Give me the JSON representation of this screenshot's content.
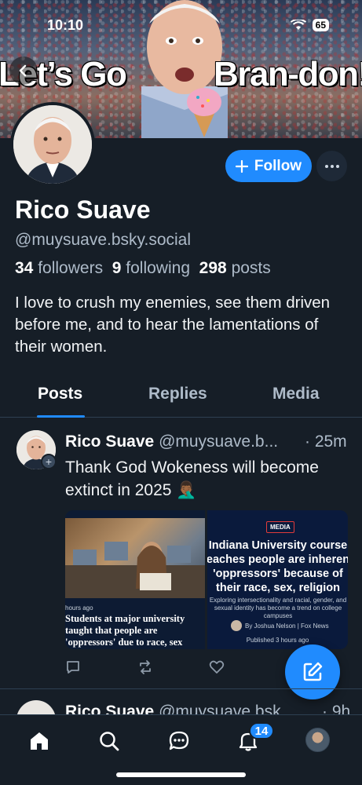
{
  "status_bar": {
    "time": "10:10",
    "battery": "65"
  },
  "banner": {
    "left_text": "Let’s Go",
    "right_text": "Bran-don!"
  },
  "profile": {
    "follow_label": "Follow",
    "display_name": "Rico Suave",
    "handle": "@muysuave.bsky.social",
    "followers_count": "34",
    "followers_label": "followers",
    "following_count": "9",
    "following_label": "following",
    "posts_count": "298",
    "posts_label": "posts",
    "bio": "I love to crush my enemies, see them driven before me, and to hear the lamentations of their women."
  },
  "tabs": [
    {
      "label": "Posts",
      "active": true
    },
    {
      "label": "Replies",
      "active": false
    },
    {
      "label": "Media",
      "active": false
    }
  ],
  "post": {
    "author": "Rico Suave",
    "handle": "@muysuave.b...",
    "time": "· 25m",
    "text": "Thank God Wokeness will become extinct in 2025 🤦🏾‍♂️",
    "image_left": {
      "time": "hours ago",
      "caption": "Students at major university taught that people are 'oppressors' due to race, sex"
    },
    "image_right": {
      "badge": "MEDIA",
      "headline": "Indiana University course teaches people are inherent 'oppressors' because of their race, sex, religion",
      "sub": "Exploring intersectionality and racial, gender, and sexual identity has become a trend on college campuses",
      "author": "By Joshua Nelson | Fox News",
      "published": "Published 3 hours ago"
    }
  },
  "post2": {
    "author": "Rico Suave",
    "handle": "@muysuave.bsk...",
    "time": "· 9h"
  },
  "nav": {
    "notifications_badge": "14"
  },
  "colors": {
    "accent": "#208bfe",
    "background": "#161e27",
    "muted": "#aebbc9"
  }
}
